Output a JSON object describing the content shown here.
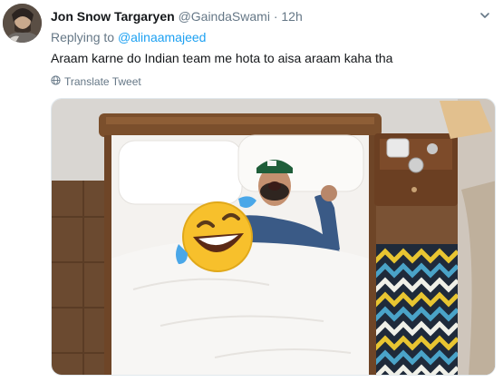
{
  "tweet": {
    "display_name": "Jon Snow Targaryen",
    "handle": "@GaindaSwami",
    "separator": "·",
    "timestamp": "12h",
    "replying_prefix": "Replying to",
    "replying_to": "@alinaamajeed",
    "text": "Araam karne do Indian team me hota to aisa araam kaha tha",
    "translate_label": "Translate Tweet"
  },
  "icons": {
    "caret": "chevron-down-icon",
    "translate": "globe-icon",
    "media_overlay": "rolling-on-floor-laughing-emoji"
  },
  "colors": {
    "link": "#1da1f2",
    "muted": "#657786",
    "text": "#14171a"
  }
}
